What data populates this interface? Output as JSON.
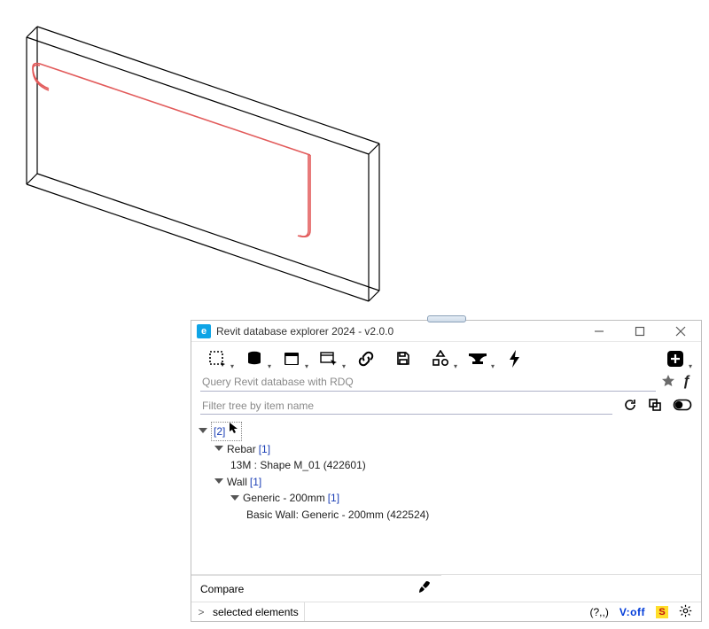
{
  "window": {
    "title": "Revit database explorer 2024 - v2.0.0"
  },
  "query": {
    "placeholder": "Query Revit database with RDQ"
  },
  "filter": {
    "placeholder": "Filter tree by item name"
  },
  "tree": {
    "root_count": "[2]",
    "rebar": {
      "label": "Rebar",
      "count": "[1]",
      "child": "13M : Shape M_01 (422601)"
    },
    "wall": {
      "label": "Wall",
      "count": "[1]",
      "type": {
        "label": "Generic - 200mm",
        "count": "[1]",
        "child": "Basic Wall: Generic - 200mm (422524)"
      }
    }
  },
  "bottom": {
    "compare": "Compare"
  },
  "status": {
    "breadcrumb": "selected elements",
    "paren": "(?,,)",
    "voff": "V:off",
    "s": "S"
  }
}
